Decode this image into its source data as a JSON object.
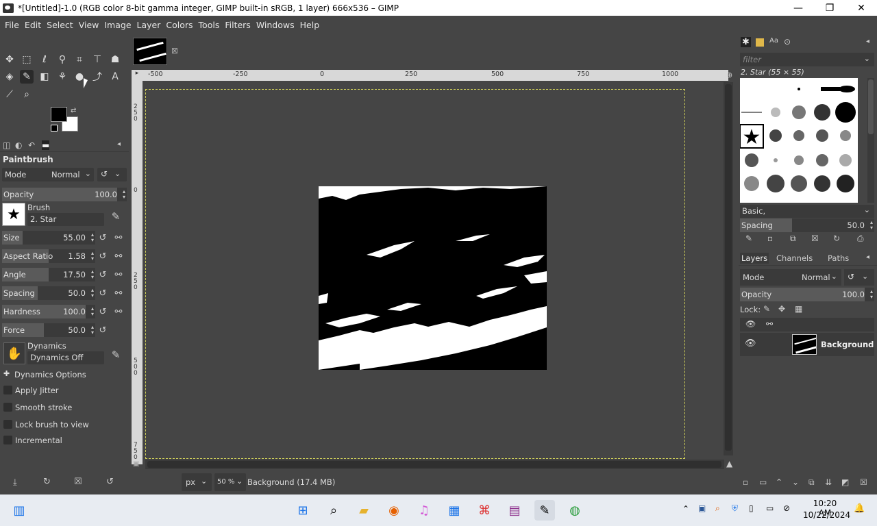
{
  "window": {
    "title": "*[Untitled]-1.0 (RGB color 8-bit gamma integer, GIMP built-in sRGB, 1 layer) 666x536 – GIMP",
    "minimize": "—",
    "maximize": "❐",
    "close": "✕"
  },
  "menu": [
    "File",
    "Edit",
    "Select",
    "View",
    "Image",
    "Layer",
    "Colors",
    "Tools",
    "Filters",
    "Windows",
    "Help"
  ],
  "tool_options": {
    "title": "Paintbrush",
    "mode_label": "Mode",
    "mode_value": "Normal",
    "opacity": {
      "label": "Opacity",
      "value": "100.0"
    },
    "brush_label": "Brush",
    "brush_value": "2. Star",
    "size": {
      "label": "Size",
      "value": "55.00"
    },
    "aspect_ratio": {
      "label": "Aspect Ratio",
      "value": "1.58"
    },
    "angle": {
      "label": "Angle",
      "value": "17.50"
    },
    "spacing": {
      "label": "Spacing",
      "value": "50.0"
    },
    "hardness": {
      "label": "Hardness",
      "value": "100.0"
    },
    "force": {
      "label": "Force",
      "value": "50.0"
    },
    "dynamics_label": "Dynamics",
    "dynamics_value": "Dynamics Off",
    "dynamics_options": "Dynamics Options",
    "apply_jitter": "Apply Jitter",
    "smooth_stroke": "Smooth stroke",
    "lock_brush": "Lock brush to view",
    "incremental": "Incremental"
  },
  "ruler": {
    "h_ticks": [
      "-250",
      "0",
      "250",
      "500",
      "750",
      "1000"
    ],
    "v_ticks": [
      "250",
      "0",
      "250",
      "500",
      "750"
    ],
    "h_first": "-500"
  },
  "status": {
    "unit": "px",
    "zoom": "50 %",
    "info": "Background (17.4 MB)"
  },
  "brushes": {
    "filter_placeholder": "filter",
    "selected": "2. Star (55 × 55)",
    "tag": "Basic,",
    "spacing_label": "Spacing",
    "spacing_value": "50.0"
  },
  "layers": {
    "tabs": [
      "Layers",
      "Channels",
      "Paths"
    ],
    "mode_label": "Mode",
    "mode_value": "Normal",
    "opacity_label": "Opacity",
    "opacity_value": "100.0",
    "lock_label": "Lock:",
    "layer_name": "Background"
  },
  "taskbar": {
    "time": "10:20 AM",
    "date": "10/22/2024"
  }
}
